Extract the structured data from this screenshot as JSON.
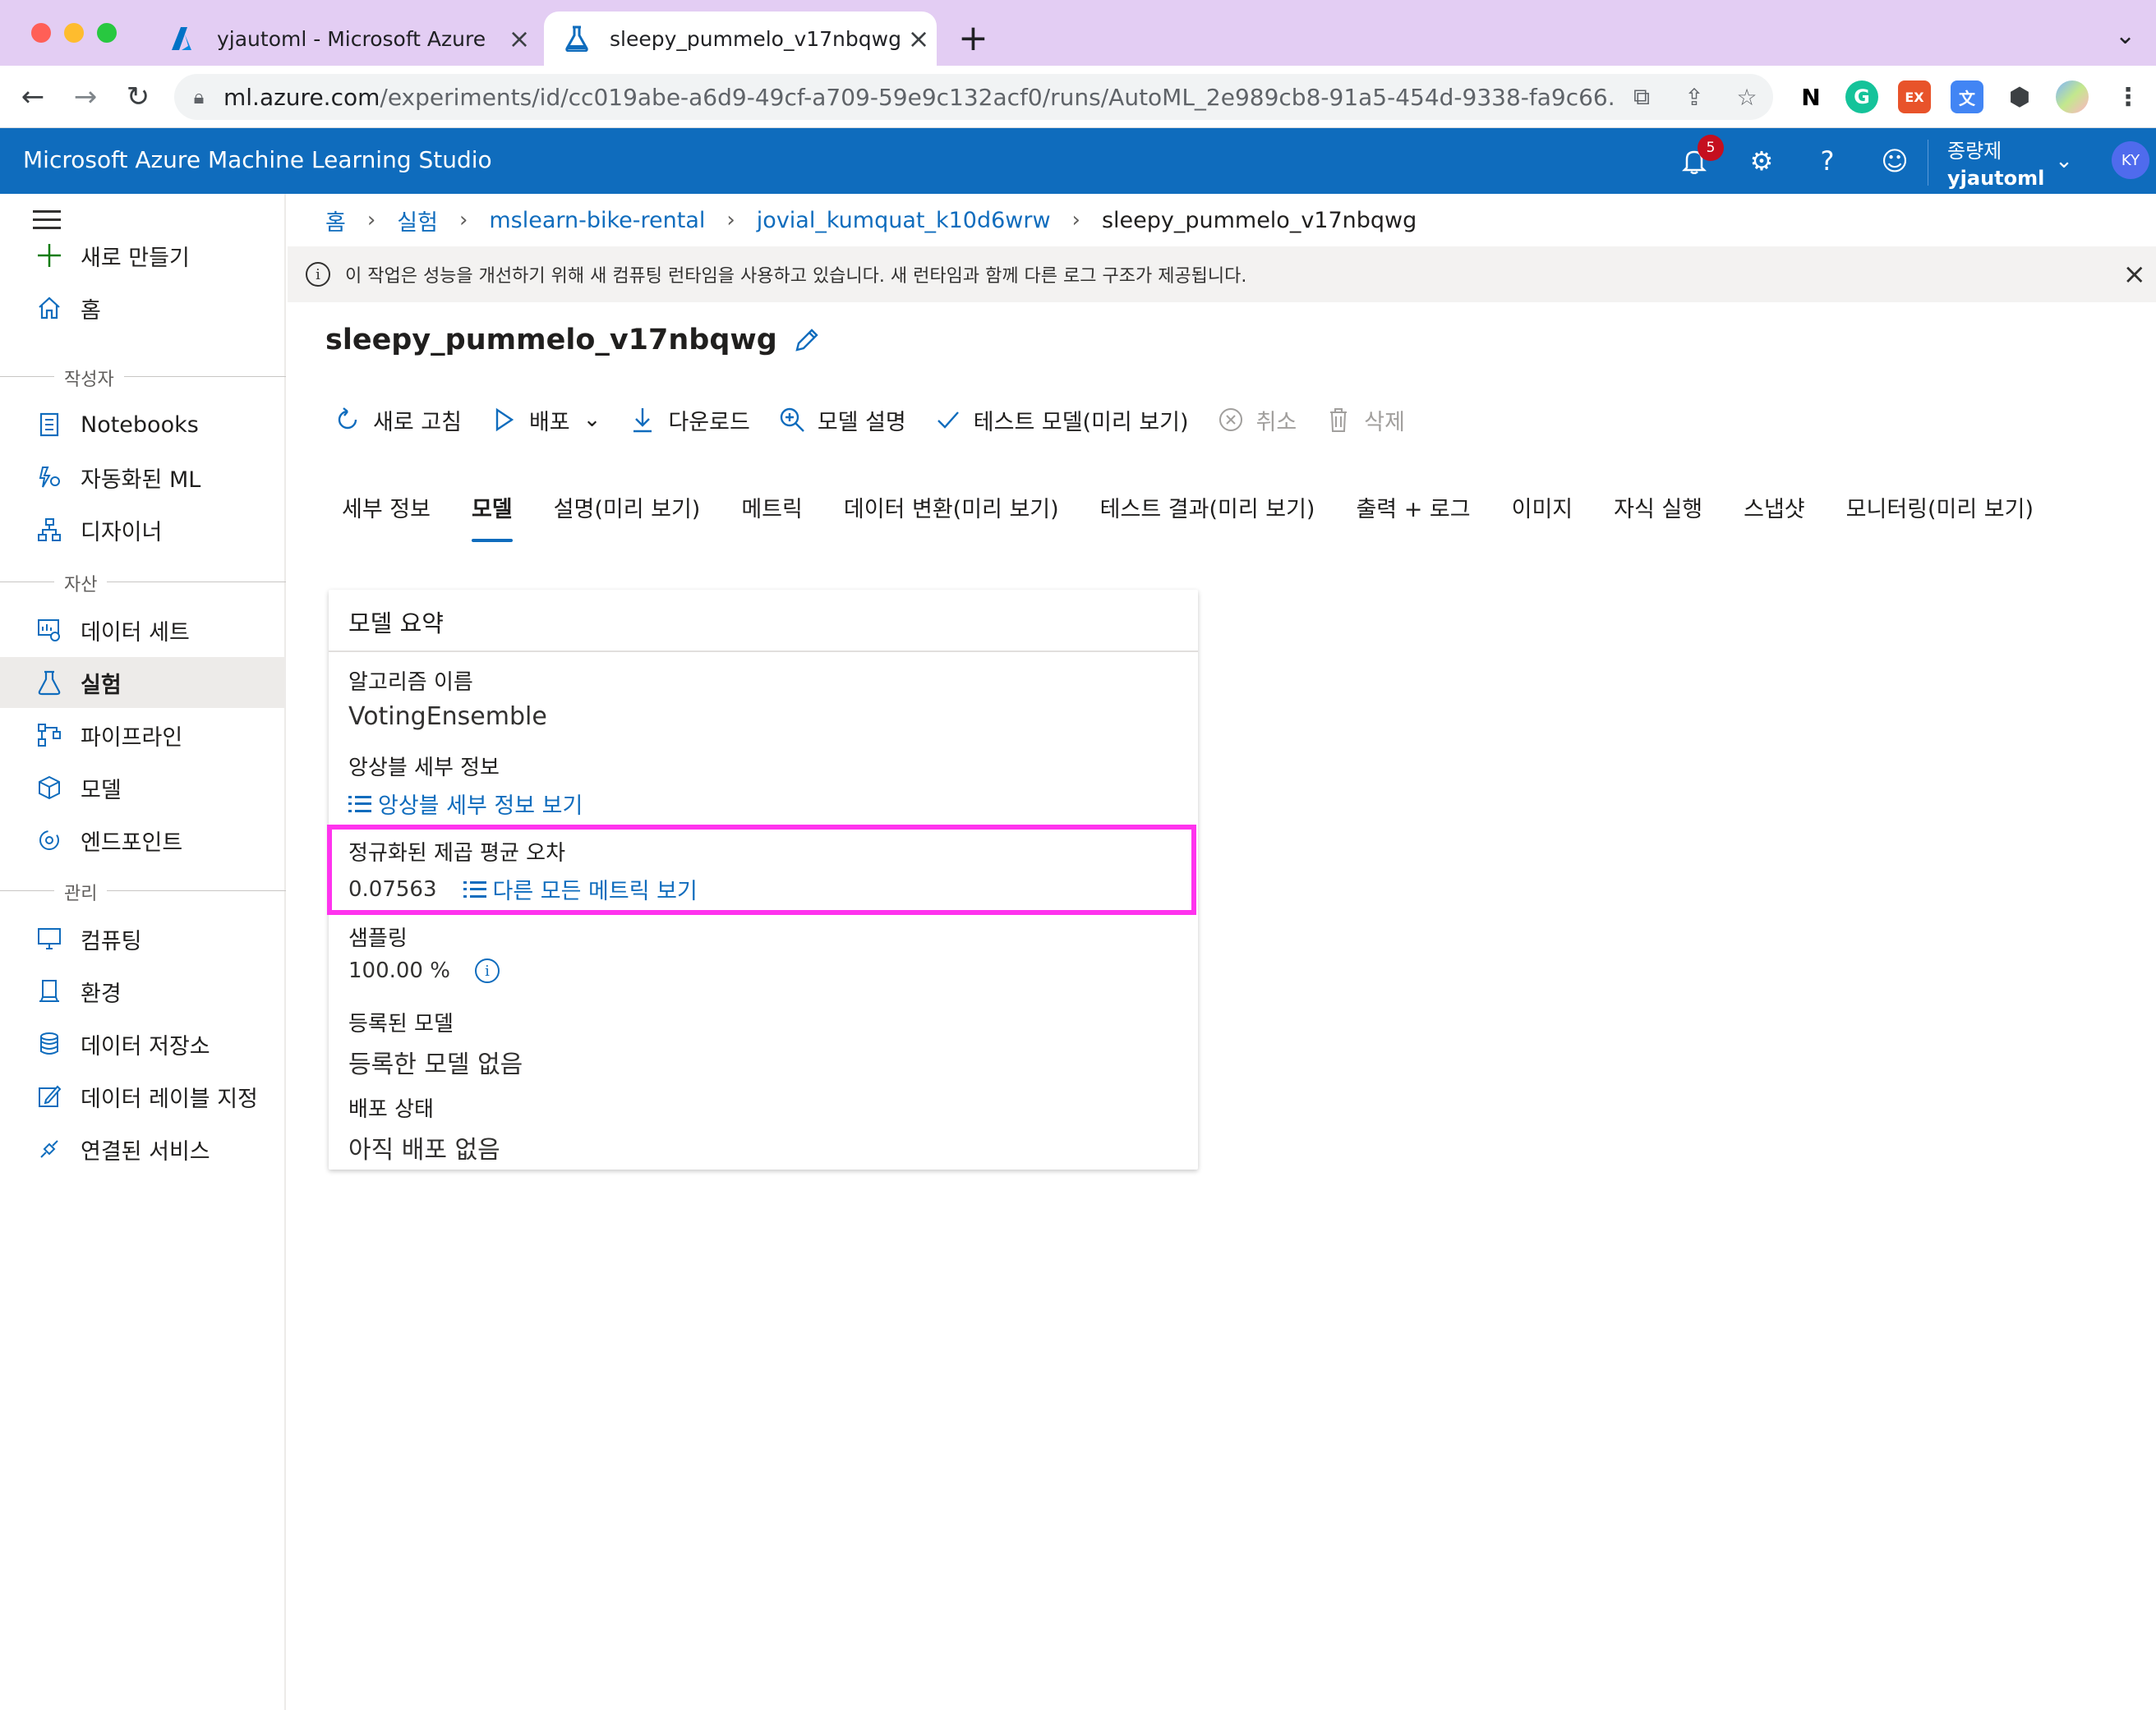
{
  "browser": {
    "tabs": [
      {
        "title": "yjautoml - Microsoft Azure",
        "active": false
      },
      {
        "title": "sleepy_pummelo_v17nbqwg - ",
        "active": true
      }
    ],
    "url_host": "ml.azure.com",
    "url_path": "/experiments/id/cc019abe-a6d9-49cf-a709-59e9c132acf0/runs/AutoML_2e989cb8-91a5-454d-9338-fa9c66...",
    "extensions": [
      {
        "name": "notion-ext",
        "label": "N",
        "color": "#000000"
      },
      {
        "name": "grammarly-ext",
        "label": "G",
        "color": "#15c39a"
      },
      {
        "name": "ex-ext",
        "label": "EX",
        "color": "#e8532a"
      },
      {
        "name": "translate-ext",
        "label": "文",
        "color": "#4285f4"
      }
    ]
  },
  "header": {
    "app_title": "Microsoft Azure Machine Learning Studio",
    "notification_count": "5",
    "directory": "종량제",
    "workspace": "yjautoml",
    "avatar_initials": "KY",
    "brand_color": "#0f6cbd"
  },
  "sidebar": {
    "items": [
      {
        "label": "새로 만들기",
        "icon": "plus-icon"
      },
      {
        "label": "홈",
        "icon": "home-icon"
      },
      {
        "label": "Notebooks",
        "icon": "notebook-icon"
      },
      {
        "label": "자동화된 ML",
        "icon": "automl-icon"
      },
      {
        "label": "디자이너",
        "icon": "designer-icon"
      },
      {
        "label": "데이터 세트",
        "icon": "dataset-icon"
      },
      {
        "label": "실험",
        "icon": "flask-icon",
        "selected": true
      },
      {
        "label": "파이프라인",
        "icon": "pipeline-icon"
      },
      {
        "label": "모델",
        "icon": "cube-icon"
      },
      {
        "label": "엔드포인트",
        "icon": "endpoint-icon"
      },
      {
        "label": "컴퓨팅",
        "icon": "computer-icon"
      },
      {
        "label": "환경",
        "icon": "environment-icon"
      },
      {
        "label": "데이터 저장소",
        "icon": "database-icon"
      },
      {
        "label": "데이터 레이블 지정",
        "icon": "label-edit-icon"
      },
      {
        "label": "연결된 서비스",
        "icon": "linked-services-icon"
      }
    ],
    "sections": [
      "작성자",
      "자산",
      "관리"
    ]
  },
  "breadcrumb": {
    "home": "홈",
    "experiments": "실험",
    "experiment": "mslearn-bike-rental",
    "parent_run": "jovial_kumquat_k10d6wrw",
    "current": "sleepy_pummelo_v17nbqwg"
  },
  "infobar": {
    "message": "이 작업은 성능을 개선하기 위해 새 컴퓨팅 런타임을 사용하고 있습니다. 새 런타임과 함께 다른 로그 구조가 제공됩니다."
  },
  "run": {
    "title": "sleepy_pummelo_v17nbqwg"
  },
  "toolbar": {
    "refresh": "새로 고침",
    "deploy": "배포",
    "download": "다운로드",
    "explain": "모델 설명",
    "test_model": "테스트 모델(미리 보기)",
    "cancel": "취소",
    "delete": "삭제"
  },
  "tabs": [
    {
      "label": "세부 정보",
      "active": false
    },
    {
      "label": "모델",
      "active": true
    },
    {
      "label": "설명(미리 보기)",
      "active": false
    },
    {
      "label": "메트릭",
      "active": false
    },
    {
      "label": "데이터 변환(미리 보기)",
      "active": false
    },
    {
      "label": "테스트 결과(미리 보기)",
      "active": false
    },
    {
      "label": "출력 + 로그",
      "active": false
    },
    {
      "label": "이미지",
      "active": false
    },
    {
      "label": "자식 실행",
      "active": false
    },
    {
      "label": "스냅샷",
      "active": false
    },
    {
      "label": "모니터링(미리 보기)",
      "active": false
    }
  ],
  "model_summary": {
    "title": "모델 요약",
    "algorithm_label": "알고리즘 이름",
    "algorithm_value": "VotingEnsemble",
    "ensemble_label": "앙상블 세부 정보",
    "ensemble_link": "앙상블 세부 정보 보기",
    "metric_label": "정규화된 제곱 평균 오차",
    "metric_value": "0.07563",
    "metric_link": "다른 모든 메트릭 보기",
    "sampling_label": "샘플링",
    "sampling_value": "100.00 %",
    "registered_label": "등록된 모델",
    "registered_value": "등록한 모델 없음",
    "deploy_label": "배포 상태",
    "deploy_value": "아직 배포 없음",
    "highlight_color": "#ff33ee"
  }
}
